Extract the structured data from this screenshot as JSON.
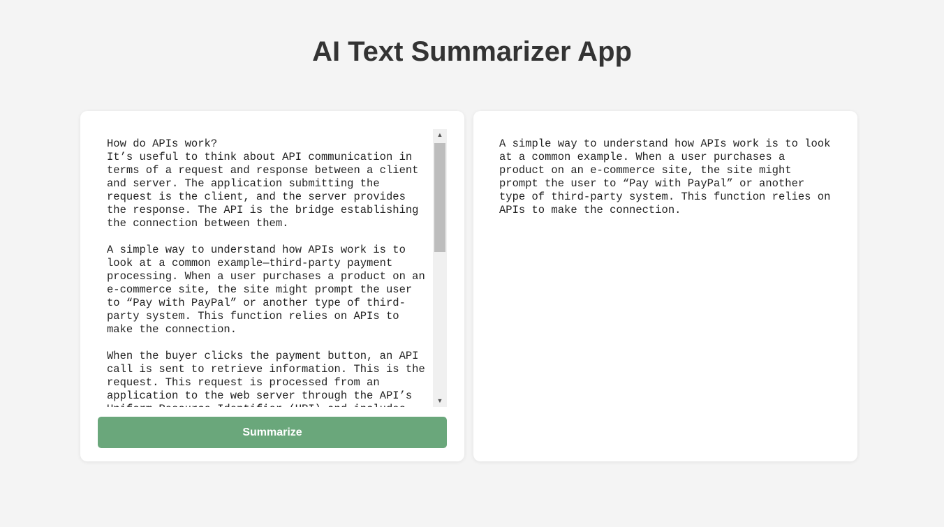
{
  "header": {
    "title": "AI Text Summarizer App"
  },
  "input_panel": {
    "text": "How do APIs work?\nIt’s useful to think about API communication in terms of a request and response between a client and server. The application submitting the request is the client, and the server provides the response. The API is the bridge establishing the connection between them.\n\nA simple way to understand how APIs work is to look at a common example—third-party payment processing. When a user purchases a product on an e-commerce site, the site might prompt the user to “Pay with PayPal” or another type of third-party system. This function relies on APIs to make the connection.\n\nWhen the buyer clicks the payment button, an API call is sent to retrieve information. This is the request. This request is processed from an application to the web server through the API’s Uniform Resource Identifier (URI) and includes",
    "button_label": "Summarize"
  },
  "output_panel": {
    "text": "A simple way to understand how APIs work is to look at a common example. When a user purchases a product on an e-commerce site, the site might prompt the user to “Pay with PayPal” or another type of third-party system. This function relies on APIs to make the connection."
  },
  "colors": {
    "background": "#f4f4f4",
    "panel": "#ffffff",
    "button": "#6aa77b",
    "title": "#333333"
  },
  "icons": {
    "scroll_up": "scroll-up-arrow-icon",
    "scroll_down": "scroll-down-arrow-icon"
  }
}
